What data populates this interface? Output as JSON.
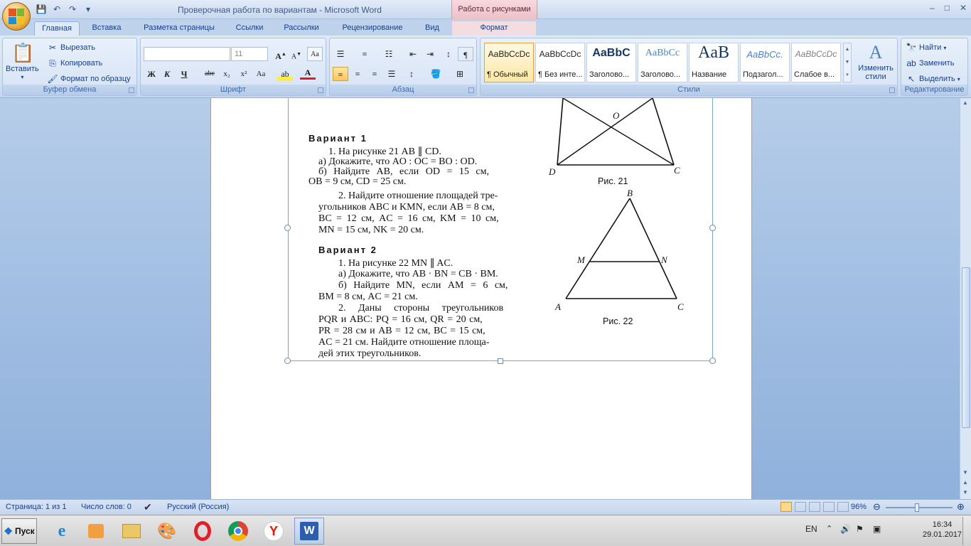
{
  "window": {
    "title": "Проверочная работа по вариантам - Microsoft Word",
    "contextual_group": "Работа с рисунками",
    "controls": [
      "–",
      "□",
      "✕"
    ]
  },
  "tabs": [
    "Главная",
    "Вставка",
    "Разметка страницы",
    "Ссылки",
    "Рассылки",
    "Рецензирование",
    "Вид",
    "Формат"
  ],
  "ribbon": {
    "clipboard": {
      "paste": "Вставить",
      "cut": "Вырезать",
      "copy": "Копировать",
      "format_painter": "Формат по образцу",
      "label": "Буфер обмена"
    },
    "font": {
      "font_name": "",
      "font_size": "11",
      "label": "Шрифт",
      "bold": "Ж",
      "italic": "К",
      "underline": "Ч",
      "strike": "abe",
      "subscript": "x₂",
      "superscript": "x²",
      "change_case": "Aa"
    },
    "paragraph": {
      "label": "Абзац"
    },
    "styles": {
      "items": [
        {
          "sample": "AaBbCcDc",
          "name": "¶ Обычный"
        },
        {
          "sample": "AaBbCcDc",
          "name": "¶ Без инте..."
        },
        {
          "sample": "AaBbC",
          "name": "Заголово..."
        },
        {
          "sample": "AaBbCc",
          "name": "Заголово..."
        },
        {
          "sample": "AaB",
          "name": "Название"
        },
        {
          "sample": "AaBbCc.",
          "name": "Подзагол..."
        },
        {
          "sample": "AaBbCcDc",
          "name": "Слабое в..."
        }
      ],
      "change_styles": "Изменить стили",
      "label": "Стили"
    },
    "editing": {
      "find": "Найти",
      "replace": "Заменить",
      "select": "Выделить",
      "label": "Редактирование"
    }
  },
  "document": {
    "variant1": {
      "heading": "Вариант 1",
      "lines": [
        "1. На рисунке 21 AB ∥ CD.",
        "а) Докажите, что AO : OC = BO : OD.",
        "б) Найдите AB, если OD = 15 см,",
        "OB = 9 см, CD = 25 см.",
        "2. Найдите отношение площадей тре-",
        "угольников ABC и KMN, если AB = 8 см,",
        "BC = 12 см, AC = 16 см, KM = 10 см,",
        "MN = 15 см, NK = 20 см."
      ]
    },
    "variant2": {
      "heading": "Вариант 2",
      "lines": [
        "1. На рисунке 22 MN ∥ AC.",
        "а) Докажите, что AB · BN = CB · BM.",
        "б) Найдите MN, если AM = 6 см,",
        "BM = 8 см, AC = 21 см.",
        "2. Даны стороны треугольников",
        "PQR и ABC: PQ = 16 см, QR = 20 см,",
        "PR = 28 см и AB = 12 см, BC = 15 см,",
        "AC = 21 см. Найдите отношение площа-",
        "дей этих треугольников."
      ]
    },
    "fig21": {
      "caption": "Рис. 21",
      "labels": {
        "O": "O",
        "D": "D",
        "C": "C"
      }
    },
    "fig22": {
      "caption": "Рис. 22",
      "labels": {
        "B": "B",
        "M": "M",
        "N": "N",
        "A": "A",
        "C": "C"
      }
    }
  },
  "statusbar": {
    "page": "Страница: 1 из 1",
    "words": "Число слов: 0",
    "language": "Русский (Россия)",
    "zoom": "96%"
  },
  "taskbar": {
    "start": "Пуск",
    "lang": "EN",
    "time": "16:34",
    "date": "29.01.2017"
  }
}
